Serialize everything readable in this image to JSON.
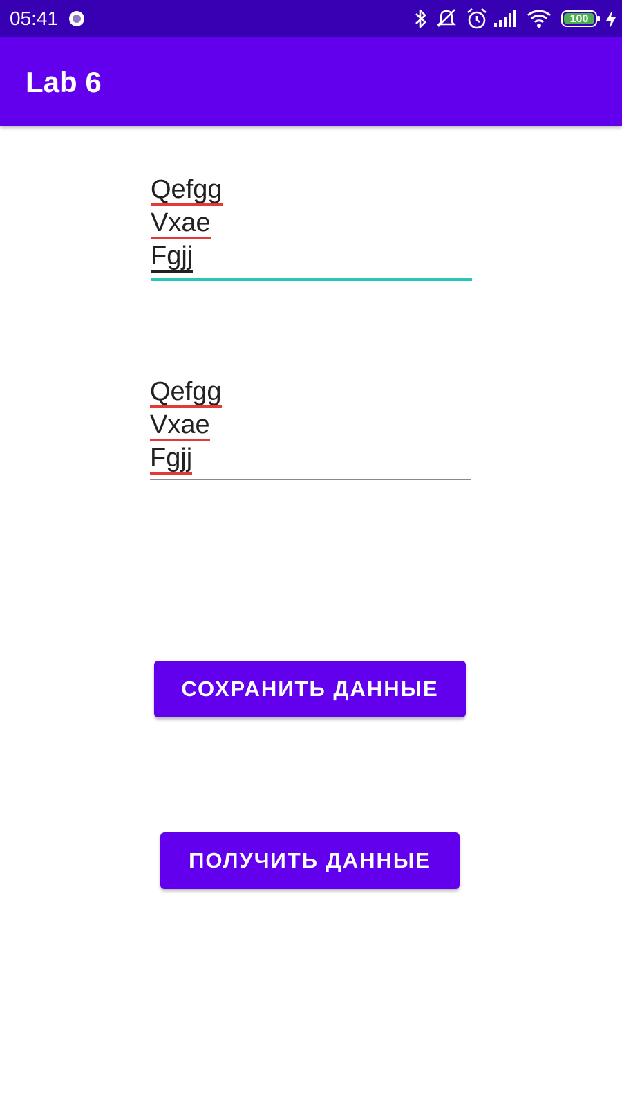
{
  "status_bar": {
    "time": "05:41",
    "battery": "100",
    "icons": [
      "record-icon",
      "bluetooth-icon",
      "notifications-off-icon",
      "alarm-icon",
      "signal-icon",
      "wifi-icon",
      "battery-icon",
      "charging-icon"
    ]
  },
  "app_bar": {
    "title": "Lab 6"
  },
  "colors": {
    "status_bar": "#3700b3",
    "primary": "#6200ee",
    "accent": "#26c6b9",
    "spellcheck": "#e53935"
  },
  "input_field": {
    "lines": [
      "Qefgg",
      "Vxae",
      "Fgjj"
    ],
    "focused": true
  },
  "output_field": {
    "lines": [
      "Qefgg",
      "Vxae",
      "Fgjj"
    ],
    "focused": false
  },
  "buttons": {
    "save_label": "СОХРАНИТЬ ДАННЫЕ",
    "get_label": "ПОЛУЧИТЬ ДАННЫЕ"
  }
}
